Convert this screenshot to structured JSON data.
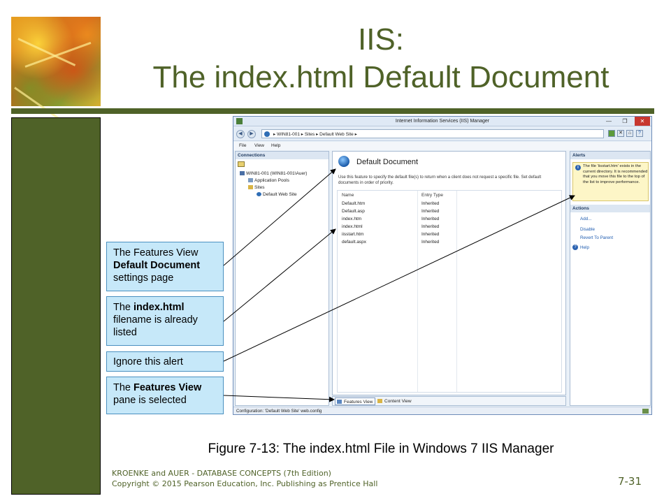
{
  "slide": {
    "title_line1": "IIS:",
    "title_line2": "The index.html Default Document",
    "caption": "Figure 7-13: The index.html File in Windows 7 IIS Manager",
    "footer_line1": "KROENKE and AUER -  DATABASE CONCEPTS (7th Edition)",
    "footer_line2": "Copyright © 2015 Pearson Education, Inc. Publishing as Prentice Hall",
    "page_number": "7-31",
    "accent_color": "#4f6228"
  },
  "window": {
    "title": "Internet Information Services (IIS) Manager",
    "breadcrumb": "▸  WIN81-001  ▸  Sites  ▸  Default Web Site  ▸",
    "menu": [
      "File",
      "View",
      "Help"
    ],
    "status": "Configuration: 'Default Web Site' web.config"
  },
  "connections": {
    "header": "Connections",
    "tree": [
      "WIN81-001 (WIN81-001\\Auer)",
      "Application Pools",
      "Sites",
      "Default Web Site"
    ]
  },
  "feature": {
    "title": "Default Document",
    "description": "Use this feature to specify the default file(s) to return when a client does not request a specific file. Set default documents in order of priority.",
    "columns": [
      "Name",
      "Entry Type"
    ],
    "rows": [
      {
        "name": "Default.htm",
        "type": "Inherited"
      },
      {
        "name": "Default.asp",
        "type": "Inherited"
      },
      {
        "name": "index.htm",
        "type": "Inherited"
      },
      {
        "name": "index.html",
        "type": "Inherited"
      },
      {
        "name": "iisstart.htm",
        "type": "Inherited"
      },
      {
        "name": "default.aspx",
        "type": "Inherited"
      }
    ],
    "tabs": [
      "Features View",
      "Content View"
    ]
  },
  "alerts": {
    "header": "Alerts",
    "text": "The file 'iisstart.htm' exists in the current directory. It is recommended that you move this file to the top of the list to improve performance."
  },
  "actions": {
    "header": "Actions",
    "items": [
      "Add...",
      "Disable",
      "Revert To Parent",
      "Help"
    ]
  },
  "callouts": {
    "c1": {
      "pre": "The Features View ",
      "bold": "Default Document",
      "post": " settings page"
    },
    "c2": {
      "pre": "The ",
      "bold": "index.html",
      "post": " filename is already listed"
    },
    "c3": {
      "pre": "Ignore this alert",
      "bold": "",
      "post": ""
    },
    "c4": {
      "pre": "The ",
      "bold": "Features View",
      "post": " pane is selected"
    }
  }
}
